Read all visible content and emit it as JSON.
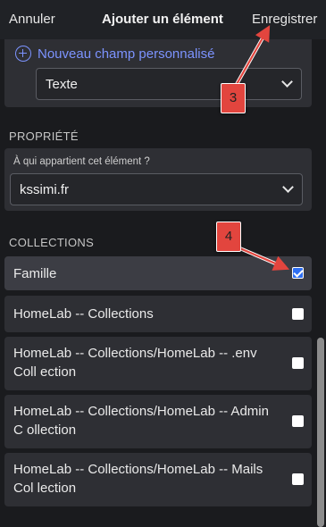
{
  "header": {
    "cancel_label": "Annuler",
    "title": "Ajouter un élément",
    "save_label": "Enregistrer"
  },
  "custom_field": {
    "new_field_label": "Nouveau champ personnalisé",
    "type_select_value": "Texte"
  },
  "property": {
    "section_label": "PROPRIÉTÉ",
    "question": "À qui appartient cet élément ?",
    "owner_select_value": "kssimi.fr"
  },
  "collections": {
    "section_label": "COLLECTIONS",
    "items": [
      {
        "label": "Famille",
        "checked": true
      },
      {
        "label": "HomeLab -- Collections",
        "checked": false
      },
      {
        "label": "HomeLab -- Collections/HomeLab -- .env Coll ection",
        "checked": false
      },
      {
        "label": "HomeLab -- Collections/HomeLab -- Admin C ollection",
        "checked": false
      },
      {
        "label": "HomeLab -- Collections/HomeLab -- Mails Col lection",
        "checked": false
      }
    ]
  },
  "annotations": {
    "badge_3": "3",
    "badge_4": "4"
  },
  "colors": {
    "accent": "#7c93ff",
    "annotation": "#e2453e",
    "checkbox_checked": "#2f6ff2"
  }
}
